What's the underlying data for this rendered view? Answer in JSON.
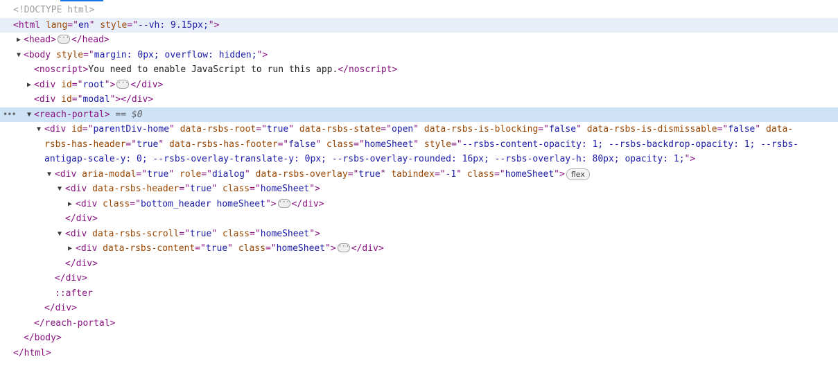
{
  "doctype": "<!DOCTYPE html>",
  "nodes": {
    "html": {
      "tag": "html",
      "attr1": "lang",
      "val1": "en",
      "attr2": "style",
      "val2": "--vh: 9.15px;"
    },
    "head": {
      "open": "<head>",
      "close": "</head>"
    },
    "body": {
      "tag": "body",
      "attr": "style",
      "val": "margin: 0px; overflow: hidden;"
    },
    "noscript": {
      "open": "<noscript>",
      "text": "You need to enable JavaScript to run this app.",
      "close": "</noscript>"
    },
    "root": {
      "tag": "div",
      "attr": "id",
      "val": "root",
      "close": "</div>"
    },
    "modal": {
      "tag": "div",
      "attr": "id",
      "val": "modal",
      "close": "</div>"
    },
    "portal": {
      "open": "<reach-portal>",
      "eq": " == $0",
      "close": "</reach-portal>"
    },
    "parent_div": {
      "line1": {
        "tag": "div",
        "a1": "id",
        "v1": "parentDiv-home",
        "a2": "data-rsbs-root",
        "v2": "true",
        "a3": "data-rsbs-state",
        "v3": "open",
        "a4": "data-rsbs-is-blocking",
        "v4": "false",
        "a5": "data-rsbs-is-dismissable",
        "v5": "false",
        "a6_part": "data-"
      },
      "line2": {
        "a6_rest": "rsbs-has-header",
        "v6": "true",
        "a7": "data-rsbs-has-footer",
        "v7": "false",
        "a8": "class",
        "v8": "homeSheet",
        "a9": "style",
        "v9_part": "--rsbs-content-opacity: 1; --rsbs-backdrop-opacity: 1; --rsbs-"
      },
      "line3": {
        "v9_rest": "antigap-scale-y: 0; --rsbs-overlay-translate-y: 0px; --rsbs-overlay-rounded: 16px; --rsbs-overlay-h: 80px; opacity: 1;"
      },
      "close": "</div>"
    },
    "dialog": {
      "tag": "div",
      "a1": "aria-modal",
      "v1": "true",
      "a2": "role",
      "v2": "dialog",
      "a3": "data-rsbs-overlay",
      "v3": "true",
      "a4": "tabindex",
      "v4": "-1",
      "a5": "class",
      "v5": "homeSheet",
      "badge": "flex",
      "close": "</div>"
    },
    "header": {
      "tag": "div",
      "a1": "data-rsbs-header",
      "v1": "true",
      "a2": "class",
      "v2": "homeSheet",
      "close": "</div>"
    },
    "bottom_header": {
      "tag": "div",
      "a1": "class",
      "v1": "bottom_header homeSheet",
      "close": "</div>"
    },
    "scroll": {
      "tag": "div",
      "a1": "data-rsbs-scroll",
      "v1": "true",
      "a2": "class",
      "v2": "homeSheet",
      "close": "</div>"
    },
    "content": {
      "tag": "div",
      "a1": "data-rsbs-content",
      "v1": "true",
      "a2": "class",
      "v2": "homeSheet",
      "close": "</div>"
    },
    "after": "::after",
    "body_close": "</body>",
    "html_close": "</html>"
  }
}
